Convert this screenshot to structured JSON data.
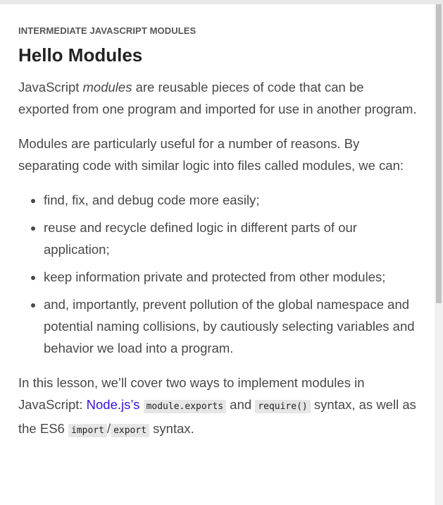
{
  "eyebrow": "INTERMEDIATE JAVASCRIPT MODULES",
  "title": "Hello Modules",
  "p1": {
    "a": "JavaScript ",
    "em": "modules",
    "b": " are reusable pieces of code that can be exported from one program and imported for use in another program."
  },
  "p2": "Modules are particularly useful for a number of reasons. By separating code with similar logic into files called modules, we can:",
  "list": [
    "find, fix, and debug code more easily;",
    "reuse and recycle defined logic in different parts of our application;",
    "keep information private and protected from other modules;",
    "and, importantly, prevent pollution of the global namespace and potential naming collisions, by cautiously selecting variables and behavior we load into a program."
  ],
  "p3": {
    "a": "In this lesson, we’ll cover two ways to implement modules in JavaScript: ",
    "link": "Node.js’s",
    "code1": "module.exports",
    "b": " and ",
    "code2": "require()",
    "c": " syntax, as well as the ES6 ",
    "code3": "import",
    "slash": "/",
    "code4": "export",
    "d": " syntax."
  }
}
